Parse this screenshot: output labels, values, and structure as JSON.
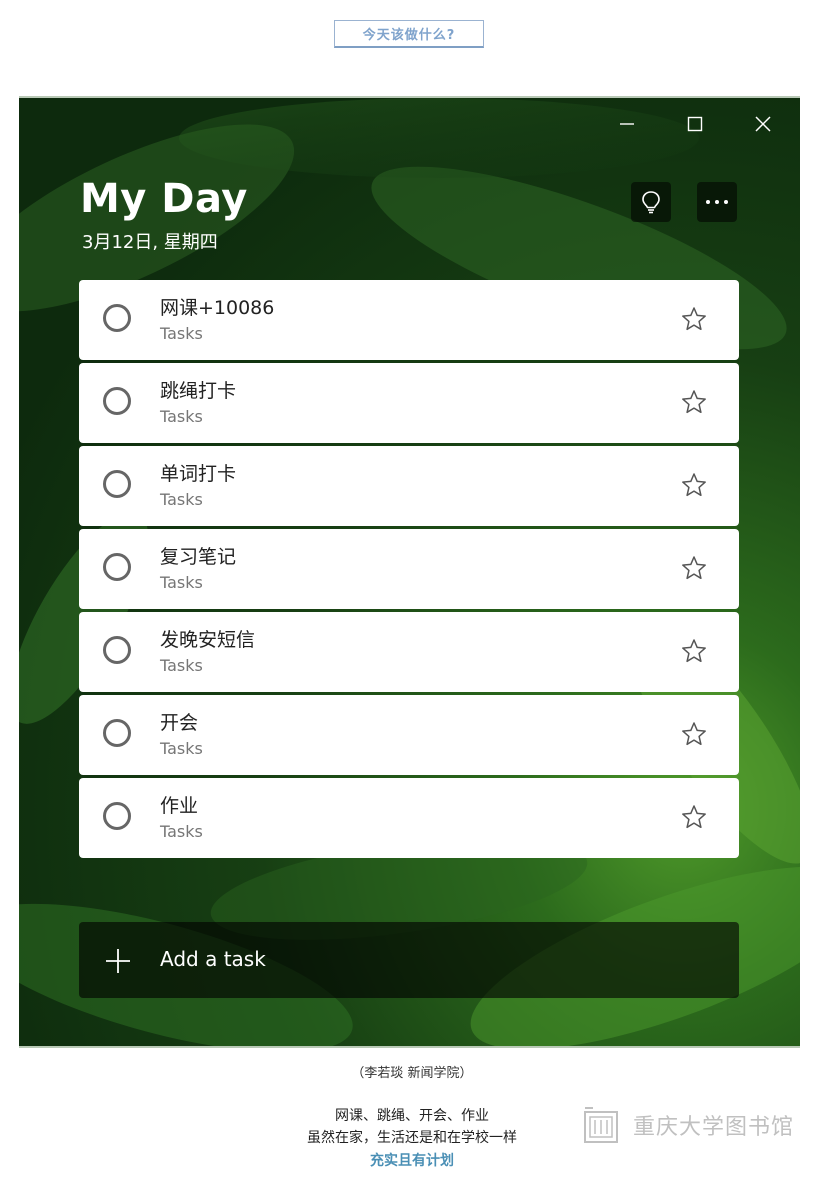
{
  "banner": {
    "label": "今天该做什么?"
  },
  "window": {
    "controls": {
      "minimize": "minimize-icon",
      "maximize": "maximize-icon",
      "close": "close-icon"
    }
  },
  "header": {
    "title": "My Day",
    "date": "3月12日, 星期四",
    "suggestions_icon": "lightbulb-icon",
    "more_icon": "more-icon"
  },
  "tasks": [
    {
      "name": "网课+10086",
      "list": "Tasks"
    },
    {
      "name": "跳绳打卡",
      "list": "Tasks"
    },
    {
      "name": "单词打卡",
      "list": "Tasks"
    },
    {
      "name": "复习笔记",
      "list": "Tasks"
    },
    {
      "name": "发晚安短信",
      "list": "Tasks"
    },
    {
      "name": "开会",
      "list": "Tasks"
    },
    {
      "name": "作业",
      "list": "Tasks"
    }
  ],
  "add_task": {
    "label": "Add a task"
  },
  "caption": "（李若琰  新闻学院）",
  "footer": {
    "line1": "网课、跳绳、开会、作业",
    "line2": "虽然在家，生活还是和在学校一样",
    "line3": "充实且有计划"
  },
  "logo": {
    "text": "重庆大学图书馆"
  },
  "colors": {
    "accent_footer": "#4a8fb5",
    "banner_text": "#7fa3cc",
    "bg_green": "#173f13"
  }
}
